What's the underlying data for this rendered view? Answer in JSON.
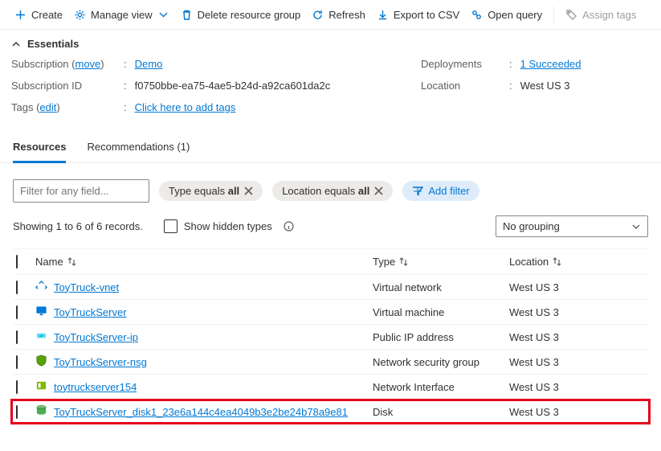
{
  "toolbar": {
    "create": "Create",
    "manage_view": "Manage view",
    "delete_rg": "Delete resource group",
    "refresh": "Refresh",
    "export_csv": "Export to CSV",
    "open_query": "Open query",
    "assign_tags": "Assign tags"
  },
  "essentials": {
    "heading": "Essentials",
    "subscription_label": "Subscription",
    "subscription_move": "move",
    "subscription_value": "Demo",
    "subscription_id_label": "Subscription ID",
    "subscription_id_value": "f0750bbe-ea75-4ae5-b24d-a92ca601da2c",
    "tags_label": "Tags",
    "tags_edit": "edit",
    "tags_value": "Click here to add tags",
    "deployments_label": "Deployments",
    "deployments_value": "1 Succeeded",
    "location_label": "Location",
    "location_value": "West US 3"
  },
  "tabs": {
    "resources": "Resources",
    "recommendations": "Recommendations (1)"
  },
  "filters": {
    "placeholder": "Filter for any field...",
    "type_prefix": "Type equals ",
    "type_value": "all",
    "location_prefix": "Location equals ",
    "location_value": "all",
    "add_filter": "Add filter"
  },
  "status": {
    "records": "Showing 1 to 6 of 6 records.",
    "show_hidden": "Show hidden types",
    "no_grouping": "No grouping"
  },
  "columns": {
    "name": "Name",
    "type": "Type",
    "location": "Location"
  },
  "rows": [
    {
      "name": "ToyTruck-vnet",
      "type": "Virtual network",
      "location": "West US 3",
      "icon": "vnet"
    },
    {
      "name": "ToyTruckServer",
      "type": "Virtual machine",
      "location": "West US 3",
      "icon": "vm"
    },
    {
      "name": "ToyTruckServer-ip",
      "type": "Public IP address",
      "location": "West US 3",
      "icon": "ip"
    },
    {
      "name": "ToyTruckServer-nsg",
      "type": "Network security group",
      "location": "West US 3",
      "icon": "nsg"
    },
    {
      "name": "toytruckserver154",
      "type": "Network Interface",
      "location": "West US 3",
      "icon": "nic"
    },
    {
      "name": "ToyTruckServer_disk1_23e6a144c4ea4049b3e2be24b78a9e81",
      "type": "Disk",
      "location": "West US 3",
      "icon": "disk",
      "highlight": true
    }
  ]
}
